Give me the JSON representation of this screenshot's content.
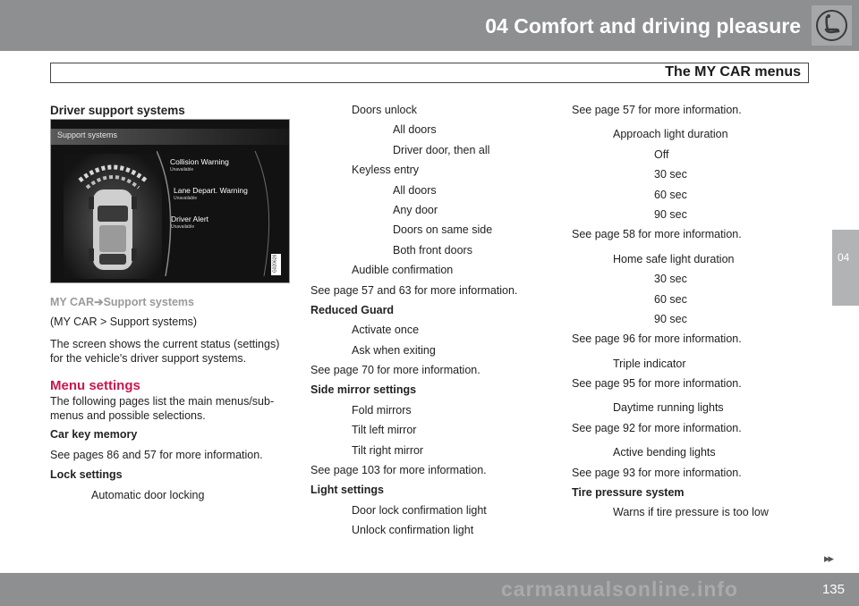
{
  "header": {
    "chapter_title": "04 Comfort and driving pleasure",
    "section_title": "The MY CAR menus",
    "chapter_icon": "seat-icon"
  },
  "side_tab": {
    "label": "04"
  },
  "footer": {
    "page_number": "135",
    "continue_icon": "double-chevron-right-icon",
    "watermark": "carmanualsonline.info"
  },
  "col1": {
    "heading": "Driver support systems",
    "screen": {
      "title": "Support systems",
      "items": [
        {
          "label": "Collision Warning",
          "status": "Unavailable"
        },
        {
          "label": "Lane Depart. Warning",
          "status": "Unavailable"
        },
        {
          "label": "Driver Alert",
          "status": "Unavailable"
        }
      ],
      "figure_code": "G020626"
    },
    "path_prefix": "MY CAR",
    "path_arrow": "➔",
    "path_suffix": "Support systems",
    "path_plain": "(MY CAR > Support systems)",
    "description": "The screen shows the current status (settings) for the vehicle's driver support systems.",
    "menu_heading": "Menu settings",
    "menu_intro": "The following pages list the main menus/sub-menus and possible selections.",
    "car_key_heading": "Car key memory",
    "car_key_ref": "See pages 86 and 57 for more information.",
    "lock_heading": "Lock settings",
    "auto_lock": "Automatic door locking"
  },
  "col2": {
    "doors_unlock": "Doors unlock",
    "all_doors_1": "All doors",
    "driver_door": "Driver door, then all",
    "keyless_entry": "Keyless entry",
    "all_doors_2": "All doors",
    "any_door": "Any door",
    "same_side": "Doors on same side",
    "both_front": "Both front doors",
    "audible": "Audible confirmation",
    "ref_57_63": "See page 57 and 63 for more information.",
    "reduced_guard": "Reduced Guard",
    "activate_once": "Activate once",
    "ask_exiting": "Ask when exiting",
    "ref_70": "See page 70 for more information.",
    "side_mirror": "Side mirror settings",
    "fold_mirrors": "Fold mirrors",
    "tilt_left": "Tilt left mirror",
    "tilt_right": "Tilt right mirror",
    "ref_103": "See page 103 for more information.",
    "light_settings": "Light settings",
    "door_lock_light": "Door lock confirmation light",
    "unlock_light": "Unlock confirmation light"
  },
  "col3": {
    "ref_57": "See page 57 for more information.",
    "approach": "Approach light duration",
    "approach_off": "Off",
    "approach_30": "30 sec",
    "approach_60": "60 sec",
    "approach_90": "90 sec",
    "ref_58": "See page 58 for more information.",
    "home_safe": "Home safe light duration",
    "home_30": "30 sec",
    "home_60": "60 sec",
    "home_90": "90 sec",
    "ref_96": "See page 96 for more information.",
    "triple": "Triple indicator",
    "ref_95": "See page 95 for more information.",
    "daytime": "Daytime running lights",
    "ref_92": "See page 92 for more information.",
    "active_bending": "Active bending lights",
    "ref_93": "See page 93 for more information.",
    "tire_pressure": "Tire pressure system",
    "tire_warn": "Warns if tire pressure is too low"
  }
}
